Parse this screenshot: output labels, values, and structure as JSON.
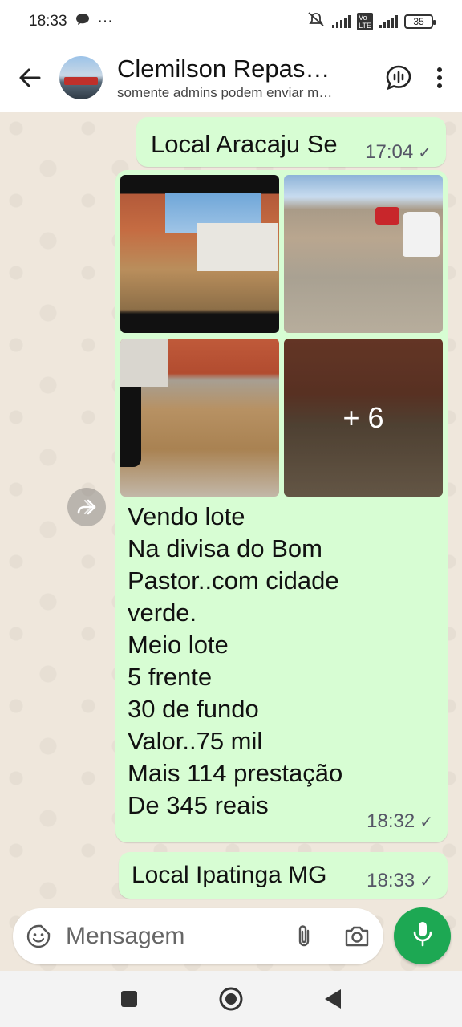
{
  "status": {
    "time": "18:33",
    "ellipsis": "···",
    "battery": "35"
  },
  "header": {
    "title": "Clemilson Repas…",
    "subtitle": "somente admins podem enviar m…"
  },
  "messages": {
    "m1": {
      "text": "Local Aracaju Se",
      "time": "17:04"
    },
    "m2": {
      "more_label": "+ 6",
      "lines": [
        "Vendo lote",
        "Na divisa do Bom",
        "Pastor..com cidade",
        "verde.",
        "Meio lote",
        "5 frente",
        "30 de fundo",
        "Valor..75 mil",
        "Mais 114 prestação",
        "De 345 reais"
      ],
      "time": "18:32"
    },
    "m3": {
      "text": "Local Ipatinga MG",
      "time": "18:33"
    }
  },
  "composer": {
    "placeholder": "Mensagem"
  },
  "colors": {
    "bubble": "#d7fdd3",
    "accent": "#1da853",
    "background": "#efe7dc"
  }
}
